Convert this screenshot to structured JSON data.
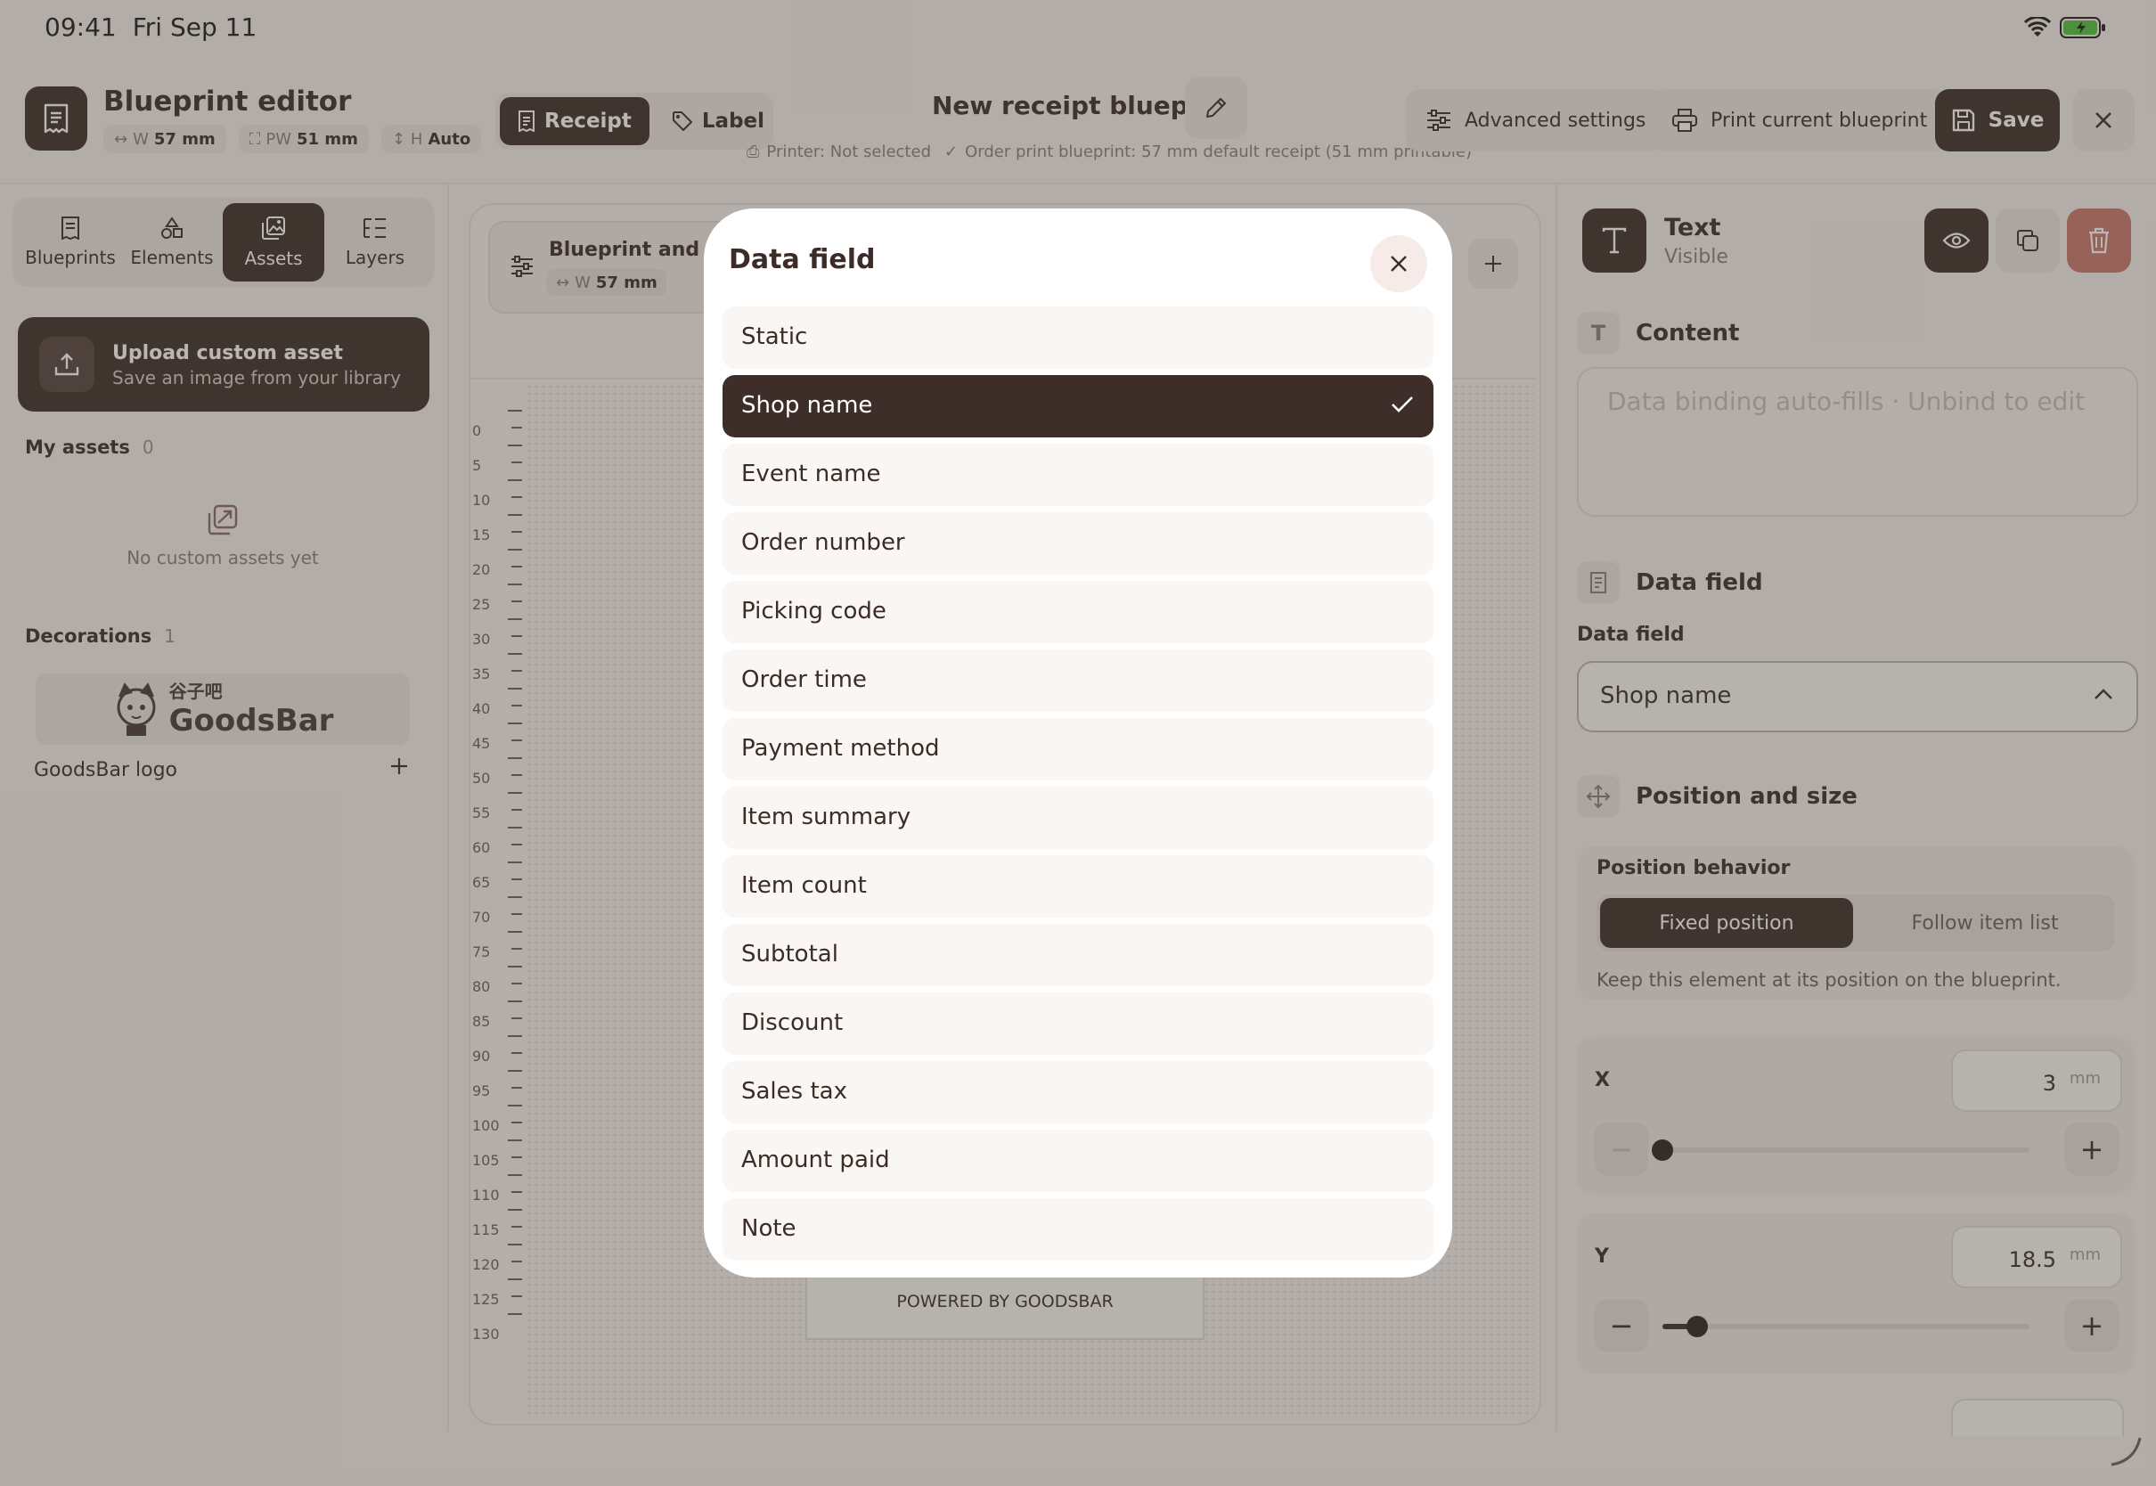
{
  "status_bar": {
    "time": "09:41",
    "date": "Fri Sep 11"
  },
  "header": {
    "app_title": "Blueprint editor",
    "dims": [
      {
        "icon": "width-arrows-icon",
        "prefix": "W",
        "value": "57 mm"
      },
      {
        "icon": "printable-width-icon",
        "prefix": "PW",
        "value": "51 mm"
      },
      {
        "icon": "height-arrow-icon",
        "prefix": "H",
        "value": "Auto"
      }
    ],
    "modes": {
      "receipt": "Receipt",
      "label": "Label",
      "active": "receipt"
    },
    "document_title": "New receipt blueprint",
    "printer_info": "Printer: Not selected",
    "order_info": "Order print blueprint: 57 mm default receipt (51 mm printable)",
    "advanced_settings": "Advanced settings",
    "print_current": "Print current blueprint",
    "save": "Save"
  },
  "left_panel": {
    "tabs": [
      {
        "label": "Blueprints",
        "icon": "receipt-icon"
      },
      {
        "label": "Elements",
        "icon": "shapes-icon"
      },
      {
        "label": "Assets",
        "icon": "images-icon",
        "active": true
      },
      {
        "label": "Layers",
        "icon": "layers-icon"
      }
    ],
    "upload": {
      "title": "Upload custom asset",
      "subtitle": "Save an image from your library"
    },
    "my_assets": {
      "label": "My assets",
      "count": "0",
      "empty": "No custom assets yet"
    },
    "decorations": {
      "label": "Decorations",
      "count": "1",
      "items": [
        {
          "name": "GoodsBar logo",
          "logo_cn": "谷子吧",
          "logo_en": "GoodsBar"
        }
      ]
    }
  },
  "canvas": {
    "toolbar_title": "Blueprint and pa",
    "chip_prefix": "W",
    "chip_value": "57 mm",
    "ruler": [
      "0",
      "5",
      "10",
      "15",
      "20",
      "25",
      "30",
      "35",
      "40",
      "45",
      "50",
      "55",
      "60",
      "65",
      "70",
      "75",
      "80",
      "85",
      "90",
      "95",
      "100",
      "105",
      "110",
      "115",
      "120",
      "125",
      "130"
    ],
    "footer_text": "POWERED BY GOODSBAR"
  },
  "right_panel": {
    "element_type": "Text",
    "element_status": "Visible",
    "content": {
      "title": "Content",
      "placeholder": "Data binding auto-fills  ·  Unbind to edit"
    },
    "data_field": {
      "title": "Data field",
      "label": "Data field",
      "value": "Shop name"
    },
    "position": {
      "title": "Position and size",
      "behavior_label": "Position behavior",
      "fixed": "Fixed position",
      "follow": "Follow item list",
      "help": "Keep this element at its position on the blueprint.",
      "x": {
        "label": "X",
        "value": "3",
        "unit": "mm",
        "slider_fraction": 0.0
      },
      "y": {
        "label": "Y",
        "value": "18.5",
        "unit": "mm",
        "slider_fraction": 0.095
      }
    }
  },
  "modal": {
    "title": "Data field",
    "selected": "Shop name",
    "options": [
      "Static",
      "Shop name",
      "Event name",
      "Order number",
      "Picking code",
      "Order time",
      "Payment method",
      "Item summary",
      "Item count",
      "Subtotal",
      "Discount",
      "Sales tax",
      "Amount paid",
      "Note"
    ]
  },
  "colors": {
    "accent": "#3d2e29",
    "background": "#f4f0ec",
    "danger": "#c9796d"
  }
}
